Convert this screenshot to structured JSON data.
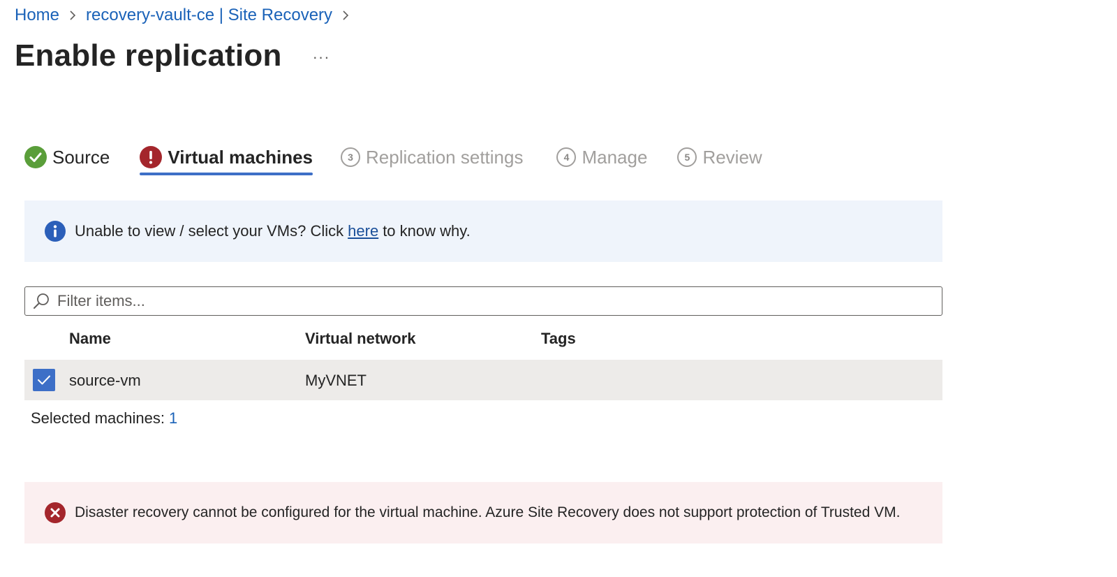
{
  "breadcrumb": {
    "items": [
      "Home",
      "recovery-vault-ce | Site Recovery"
    ]
  },
  "page": {
    "title": "Enable replication",
    "more_label": "···"
  },
  "steps": [
    {
      "label": "Source",
      "status": "done",
      "icon": "check-circle-icon"
    },
    {
      "label": "Virtual machines",
      "status": "error-active",
      "icon": "exclamation-circle-icon"
    },
    {
      "label": "Replication settings",
      "status": "pending",
      "number": "3"
    },
    {
      "label": "Manage",
      "status": "pending",
      "number": "4"
    },
    {
      "label": "Review",
      "status": "pending",
      "number": "5"
    }
  ],
  "info_banner": {
    "icon": "info-icon",
    "text_before": "Unable to view / select your VMs? Click",
    "link_text": "here",
    "text_after": "to know why."
  },
  "filter": {
    "placeholder": "Filter items...",
    "value": ""
  },
  "table": {
    "columns": [
      "Name",
      "Virtual network",
      "Tags"
    ],
    "rows": [
      {
        "selected": true,
        "name": "source-vm",
        "virtual_network": "MyVNET",
        "tags": ""
      }
    ]
  },
  "selection": {
    "label": "Selected machines:",
    "count": "1"
  },
  "error_banner": {
    "icon": "error-circle-icon",
    "text": "Disaster recovery cannot be configured for the virtual machine. Azure Site Recovery does not support protection of Trusted VM."
  },
  "colors": {
    "link": "#1a62b8",
    "accent": "#3d6fc7",
    "success": "#5a9e3a",
    "error": "#a4262c",
    "info_bg": "#eff4fb",
    "error_bg": "#fbeff0"
  }
}
